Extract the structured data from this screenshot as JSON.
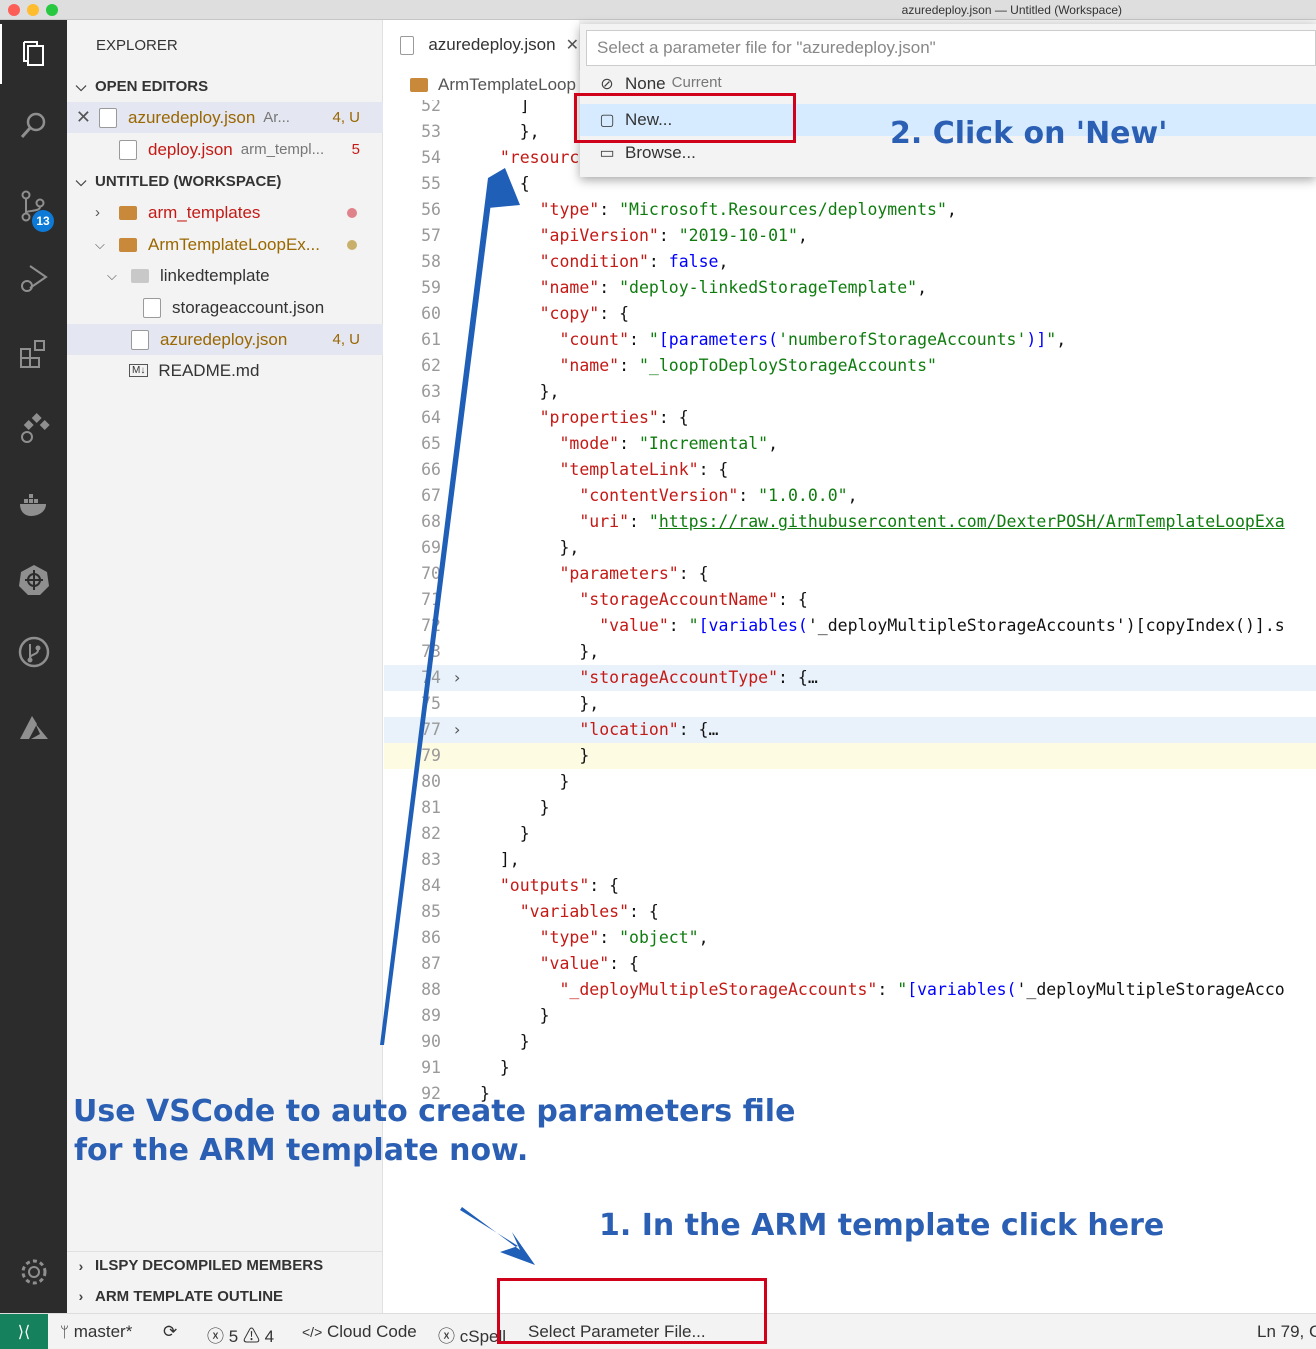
{
  "window": {
    "title": "azuredeploy.json — Untitled (Workspace)",
    "traffic_colors": [
      "#fd5f57",
      "#febc2e",
      "#28c840"
    ]
  },
  "activity": {
    "scm_badge": "13"
  },
  "sidebar": {
    "title": "EXPLORER",
    "open_editors": {
      "title": "OPEN EDITORS",
      "items": [
        {
          "name": "azuredeploy.json",
          "desc": "Ar...",
          "status": "4, U",
          "color": "#9a6700"
        },
        {
          "name": "deploy.json",
          "desc": "arm_templ...",
          "status": "5",
          "color": "#c41a16"
        }
      ]
    },
    "workspace": {
      "title": "UNTITLED (WORKSPACE)",
      "items": [
        {
          "name": "arm_templates",
          "color": "#c41a16",
          "dot": "#e0828a"
        },
        {
          "name": "ArmTemplateLoopEx...",
          "color": "#9a6700",
          "dot": "#c9b06a"
        },
        {
          "name": "linkedtemplate"
        },
        {
          "name": "storageaccount.json"
        },
        {
          "name": "azuredeploy.json",
          "status": "4, U",
          "color": "#9a6700"
        },
        {
          "name": "README.md",
          "md_icon": "M↓"
        }
      ]
    },
    "ilspy": "ILSPY DECOMPILED MEMBERS",
    "outline": "ARM TEMPLATE OUTLINE"
  },
  "editor": {
    "tab": "azuredeploy.json",
    "breadcrumb": "ArmTemplateLoop",
    "lines": [
      {
        "n": "52",
        "segs": [
          [
            "p",
            "    ]"
          ]
        ]
      },
      {
        "n": "53",
        "segs": [
          [
            "p",
            "    },"
          ]
        ]
      },
      {
        "n": "54",
        "segs": [
          [
            "p",
            "  "
          ],
          [
            "k",
            "\"resources\""
          ],
          [
            "p",
            ": ["
          ]
        ]
      },
      {
        "n": "55",
        "segs": [
          [
            "p",
            "    {"
          ]
        ]
      },
      {
        "n": "56",
        "segs": [
          [
            "p",
            "      "
          ],
          [
            "k",
            "\"type\""
          ],
          [
            "p",
            ": "
          ],
          [
            "s",
            "\"Microsoft.Resources/deployments\""
          ],
          [
            "p",
            ","
          ]
        ]
      },
      {
        "n": "57",
        "segs": [
          [
            "p",
            "      "
          ],
          [
            "k",
            "\"apiVersion\""
          ],
          [
            "p",
            ": "
          ],
          [
            "s",
            "\"2019-10-01\""
          ],
          [
            "p",
            ","
          ]
        ]
      },
      {
        "n": "58",
        "segs": [
          [
            "p",
            "      "
          ],
          [
            "k",
            "\"condition\""
          ],
          [
            "p",
            ": "
          ],
          [
            "b",
            "false"
          ],
          [
            "p",
            ","
          ]
        ]
      },
      {
        "n": "59",
        "segs": [
          [
            "p",
            "      "
          ],
          [
            "k",
            "\"name\""
          ],
          [
            "p",
            ": "
          ],
          [
            "s",
            "\"deploy-linkedStorageTemplate\""
          ],
          [
            "p",
            ","
          ]
        ]
      },
      {
        "n": "60",
        "segs": [
          [
            "p",
            "      "
          ],
          [
            "k",
            "\"copy\""
          ],
          [
            "p",
            ": {"
          ]
        ]
      },
      {
        "n": "61",
        "segs": [
          [
            "p",
            "        "
          ],
          [
            "k",
            "\"count\""
          ],
          [
            "p",
            ": "
          ],
          [
            "s",
            "\""
          ],
          [
            "b",
            "[parameters("
          ],
          [
            "s",
            "'numberofStorageAccounts'"
          ],
          [
            "b",
            ")]"
          ],
          [
            "s",
            "\""
          ],
          [
            "p",
            ","
          ]
        ]
      },
      {
        "n": "62",
        "segs": [
          [
            "p",
            "        "
          ],
          [
            "k",
            "\"name\""
          ],
          [
            "p",
            ": "
          ],
          [
            "s",
            "\"_loopToDeployStorageAccounts\""
          ]
        ]
      },
      {
        "n": "63",
        "segs": [
          [
            "p",
            "      },"
          ]
        ]
      },
      {
        "n": "64",
        "segs": [
          [
            "p",
            "      "
          ],
          [
            "k",
            "\"properties\""
          ],
          [
            "p",
            ": {"
          ]
        ]
      },
      {
        "n": "65",
        "segs": [
          [
            "p",
            "        "
          ],
          [
            "k",
            "\"mode\""
          ],
          [
            "p",
            ": "
          ],
          [
            "s",
            "\"Incremental\""
          ],
          [
            "p",
            ","
          ]
        ]
      },
      {
        "n": "66",
        "segs": [
          [
            "p",
            "        "
          ],
          [
            "k",
            "\"templateLink\""
          ],
          [
            "p",
            ": {"
          ]
        ]
      },
      {
        "n": "67",
        "segs": [
          [
            "p",
            "          "
          ],
          [
            "k",
            "\"contentVersion\""
          ],
          [
            "p",
            ": "
          ],
          [
            "s",
            "\"1.0.0.0\""
          ],
          [
            "p",
            ","
          ]
        ]
      },
      {
        "n": "68",
        "segs": [
          [
            "p",
            "          "
          ],
          [
            "k",
            "\"uri\""
          ],
          [
            "p",
            ": "
          ],
          [
            "s",
            "\""
          ],
          [
            "u",
            "https://raw.githubusercontent.com/DexterPOSH/ArmTemplateLoopExa"
          ]
        ]
      },
      {
        "n": "69",
        "segs": [
          [
            "p",
            "        },"
          ]
        ]
      },
      {
        "n": "70",
        "segs": [
          [
            "p",
            "        "
          ],
          [
            "k",
            "\"parameters\""
          ],
          [
            "p",
            ": {"
          ]
        ]
      },
      {
        "n": "71",
        "segs": [
          [
            "p",
            "          "
          ],
          [
            "k",
            "\"storageAccountName\""
          ],
          [
            "p",
            ": {"
          ]
        ]
      },
      {
        "n": "72",
        "segs": [
          [
            "p",
            "            "
          ],
          [
            "k",
            "\"value\""
          ],
          [
            "p",
            ": "
          ],
          [
            "s",
            "\""
          ],
          [
            "b",
            "[variables("
          ],
          [
            "p",
            "'_deployMultipleStorageAccounts')[copyIndex()].s"
          ]
        ]
      },
      {
        "n": "73",
        "segs": [
          [
            "p",
            "          },"
          ]
        ]
      },
      {
        "n": "74",
        "fold": true,
        "hl": true,
        "segs": [
          [
            "p",
            "          "
          ],
          [
            "k",
            "\"storageAccountType\""
          ],
          [
            "p",
            ": {…"
          ]
        ]
      },
      {
        "n": "75",
        "segs": [
          [
            "p",
            "          },"
          ]
        ]
      },
      {
        "n": "77",
        "fold": true,
        "hl": true,
        "segs": [
          [
            "p",
            "          "
          ],
          [
            "k",
            "\"location\""
          ],
          [
            "p",
            ": {…"
          ]
        ]
      },
      {
        "n": "79",
        "cur": true,
        "segs": [
          [
            "p",
            "          }"
          ]
        ]
      },
      {
        "n": "80",
        "segs": [
          [
            "p",
            "        }"
          ]
        ]
      },
      {
        "n": "81",
        "segs": [
          [
            "p",
            "      }"
          ]
        ]
      },
      {
        "n": "82",
        "segs": [
          [
            "p",
            "    }"
          ]
        ]
      },
      {
        "n": "83",
        "segs": [
          [
            "p",
            "  ],"
          ]
        ]
      },
      {
        "n": "84",
        "segs": [
          [
            "p",
            "  "
          ],
          [
            "k",
            "\"outputs\""
          ],
          [
            "p",
            ": {"
          ]
        ]
      },
      {
        "n": "85",
        "segs": [
          [
            "p",
            "    "
          ],
          [
            "k",
            "\"variables\""
          ],
          [
            "p",
            ": {"
          ]
        ]
      },
      {
        "n": "86",
        "segs": [
          [
            "p",
            "      "
          ],
          [
            "k",
            "\"type\""
          ],
          [
            "p",
            ": "
          ],
          [
            "s",
            "\"object\""
          ],
          [
            "p",
            ","
          ]
        ]
      },
      {
        "n": "87",
        "segs": [
          [
            "p",
            "      "
          ],
          [
            "k",
            "\"value\""
          ],
          [
            "p",
            ": {"
          ]
        ]
      },
      {
        "n": "88",
        "segs": [
          [
            "p",
            "        "
          ],
          [
            "k",
            "\"_deployMultipleStorageAccounts\""
          ],
          [
            "p",
            ": "
          ],
          [
            "s",
            "\""
          ],
          [
            "b",
            "[variables("
          ],
          [
            "p",
            "'_deployMultipleStorageAcco"
          ]
        ]
      },
      {
        "n": "89",
        "segs": [
          [
            "p",
            "      }"
          ]
        ]
      },
      {
        "n": "90",
        "segs": [
          [
            "p",
            "    }"
          ]
        ]
      },
      {
        "n": "91",
        "segs": [
          [
            "p",
            "  }"
          ]
        ]
      },
      {
        "n": "92",
        "segs": [
          [
            "p",
            "}"
          ]
        ]
      }
    ]
  },
  "quickpick": {
    "placeholder": "Select a parameter file for \"azuredeploy.json\"",
    "items": [
      {
        "icon": "⊘",
        "label": "None",
        "desc": "Current"
      },
      {
        "icon": "▢",
        "label": "New...",
        "selected": true
      },
      {
        "icon": "▭",
        "label": "Browse..."
      }
    ]
  },
  "statusbar": {
    "branch": "master*",
    "errors": "5",
    "warnings": "4",
    "cloud": "Cloud Code",
    "cspell": "cSpell",
    "param": "Select Parameter File...",
    "position": "Ln 79, C"
  },
  "annotations": {
    "click_new": "2. Click on 'New'",
    "intro_1": "Use VSCode to auto create parameters file",
    "intro_2": "for the ARM template now.",
    "click_here": "1. In the ARM template click here",
    "arrow_color": "#1f5fb8",
    "box_color": "#d0021b"
  }
}
